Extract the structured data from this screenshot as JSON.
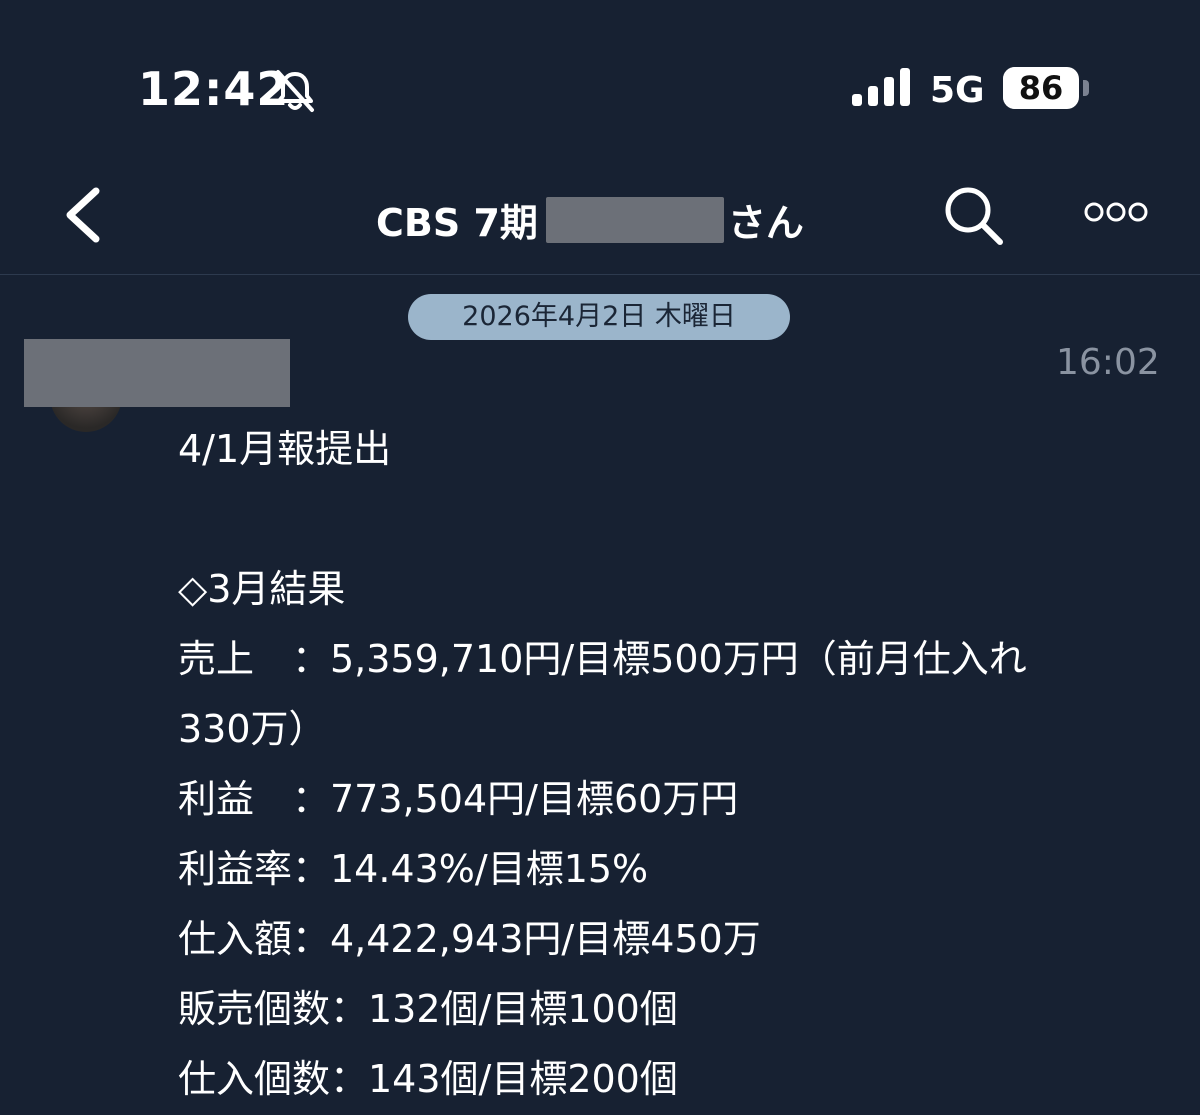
{
  "status_bar": {
    "time": "12:42",
    "network": "5G",
    "battery": "86",
    "battery_level": 0.86,
    "icons": [
      "bell-slash-icon",
      "signal-icon"
    ]
  },
  "nav": {
    "title_prefix": "CBS 7期",
    "title_suffix": "さん",
    "icons": [
      "chevron-left-icon",
      "search-icon",
      "more-icon"
    ]
  },
  "chat": {
    "date_separator": "2026年4月2日 木曜日",
    "message": {
      "time": "16:02",
      "lines": [
        "4/1月報提出",
        "",
        "◇3月結果",
        "売上　：5,359,710円/目標500万円（前月仕入れ",
        "330万）",
        "利益　：773,504円/目標60万円",
        "利益率：14.43%/目標15%",
        "仕入額：4,422,943円/目標450万",
        "販売個数：132個/目標100個",
        "仕入個数：143個/目標200個"
      ]
    }
  },
  "colors": {
    "background": "#172132",
    "date_pill": "#9bb5cb",
    "muted_text": "#8a93a1"
  }
}
